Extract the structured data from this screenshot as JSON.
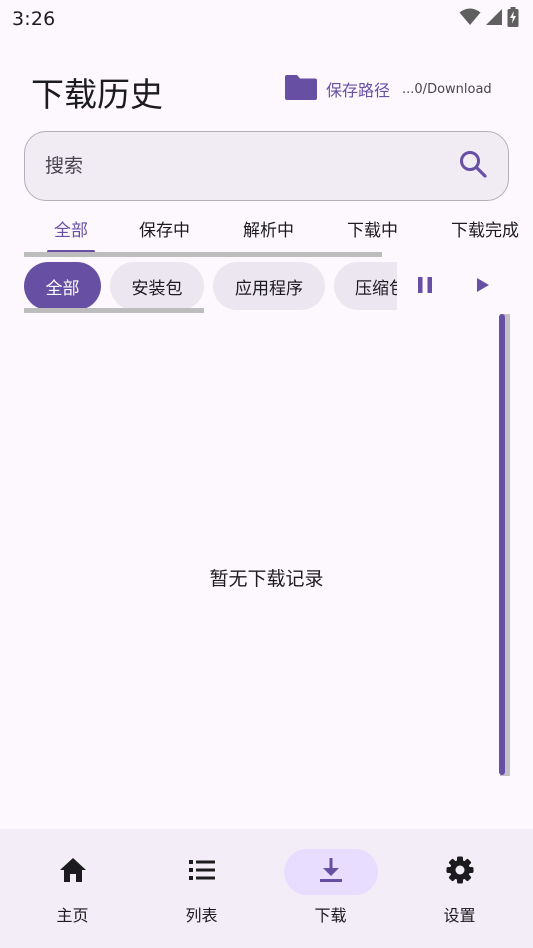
{
  "status_bar": {
    "time": "3:26",
    "icons": [
      "wifi-icon",
      "signal-icon",
      "battery-charging-icon"
    ]
  },
  "header": {
    "title": "下载历史",
    "save_path_label": "保存路径",
    "save_path_value": "...0/Download",
    "folder_icon": "folder-icon"
  },
  "search": {
    "placeholder": "搜索",
    "icon": "search-icon"
  },
  "tabs": [
    {
      "label": "全部",
      "active": true
    },
    {
      "label": "保存中"
    },
    {
      "label": "解析中"
    },
    {
      "label": "下载中"
    },
    {
      "label": "下载完成"
    }
  ],
  "chips": [
    {
      "label": "全部",
      "active": true
    },
    {
      "label": "安装包"
    },
    {
      "label": "应用程序"
    },
    {
      "label": "压缩包"
    }
  ],
  "controls": {
    "pause_icon": "pause-icon",
    "play_icon": "play-icon"
  },
  "content": {
    "empty_text": "暂无下载记录"
  },
  "bottom_nav": [
    {
      "label": "主页",
      "icon": "home-icon"
    },
    {
      "label": "列表",
      "icon": "list-icon"
    },
    {
      "label": "下载",
      "icon": "download-icon",
      "active": true
    },
    {
      "label": "设置",
      "icon": "settings-icon"
    }
  ],
  "colors": {
    "primary": "#6750a4",
    "background": "#fdf8fd",
    "surface_variant": "#ebe6ef",
    "nav_active": "#e8ddff"
  }
}
